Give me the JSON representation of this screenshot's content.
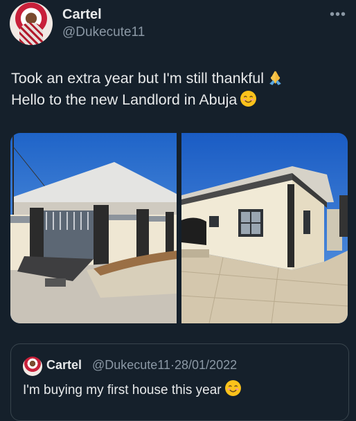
{
  "author": {
    "display_name": "Cartel",
    "handle": "@Dukecute11"
  },
  "tweet": {
    "line1": "Took an extra year but I'm still thankful",
    "line1_emoji": "folded-hands",
    "line2": "Hello to the new Landlord in Abuja",
    "line2_emoji": "smiling-face"
  },
  "media": {
    "image_count": 2
  },
  "quoted_tweet": {
    "display_name": "Cartel",
    "handle": "@Dukecute11",
    "separator": "·",
    "date": "28/01/2022",
    "text": "I'm buying my first house this year",
    "emoji": "smiling-face"
  },
  "icons": {
    "more": "more-horizontal-icon"
  },
  "colors": {
    "background": "#15202b",
    "primary_text": "#e7e9ea",
    "secondary_text": "#8b98a5",
    "border": "#38444d"
  }
}
